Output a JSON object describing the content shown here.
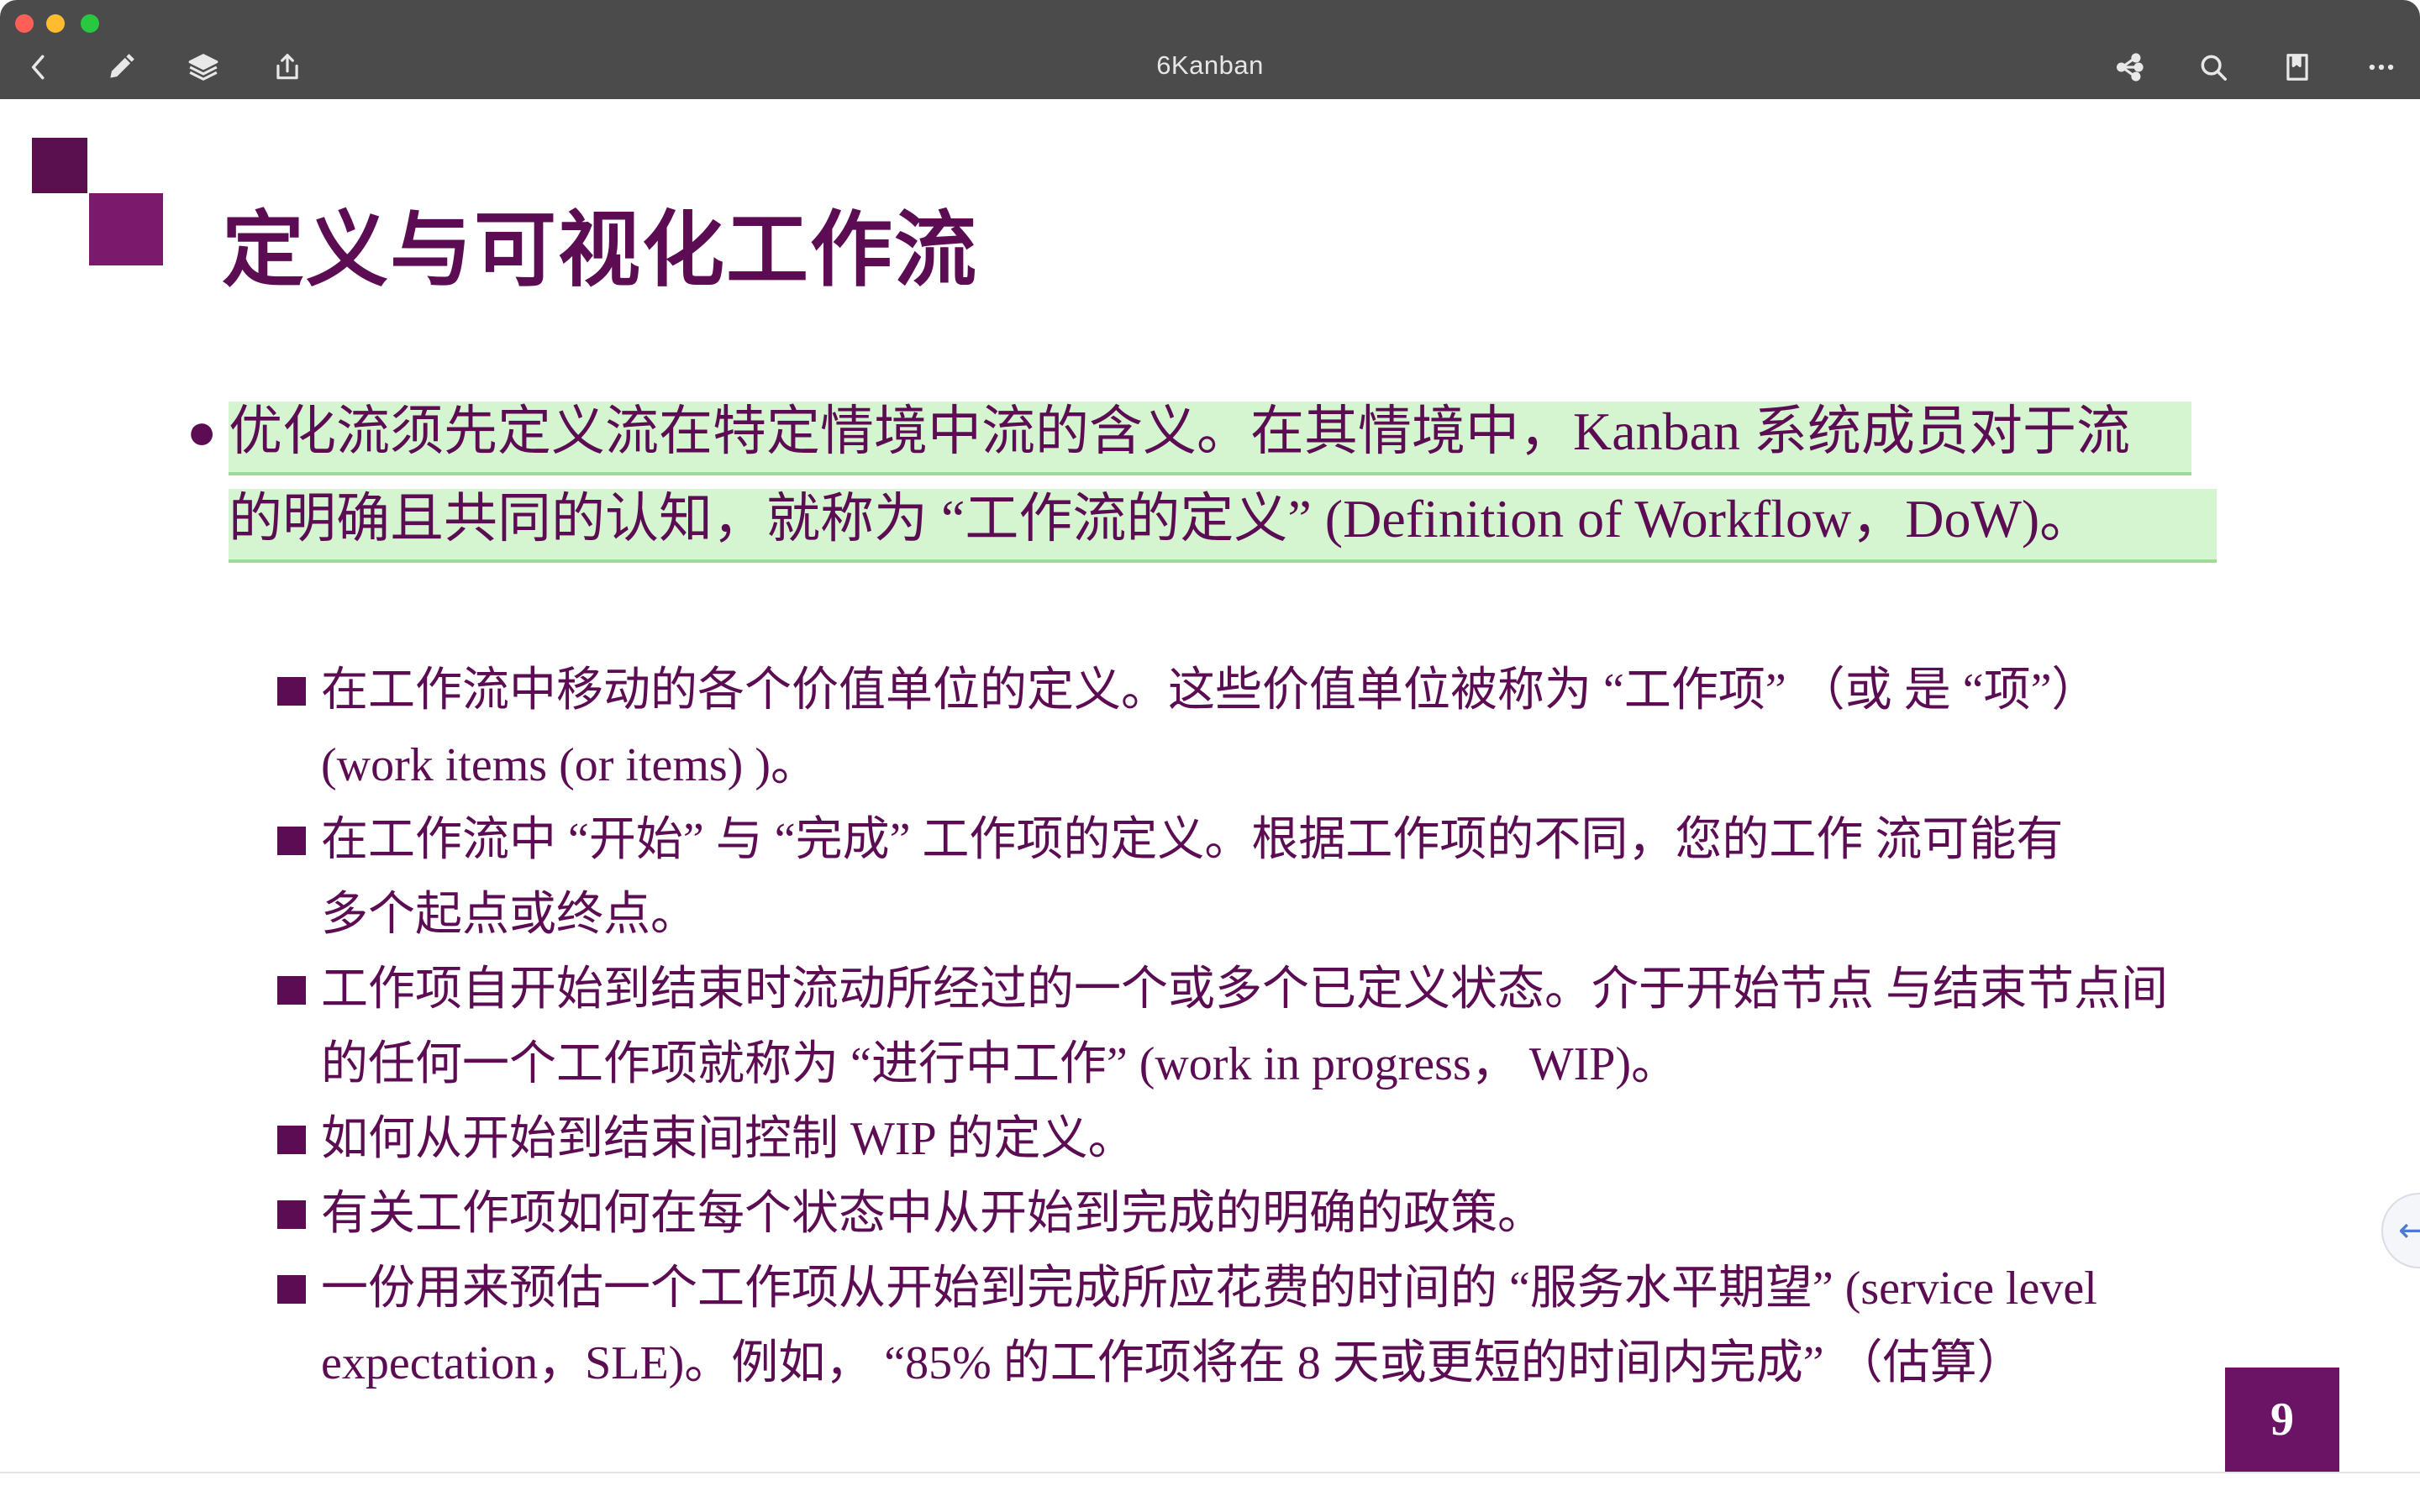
{
  "window": {
    "title": "6Kanban"
  },
  "toolbar": {
    "left_icons": [
      "back-icon",
      "pencil-icon",
      "layers-icon",
      "share-icon"
    ],
    "right_icons": [
      "mindmap-icon",
      "search-icon",
      "bookmark-icon",
      "more-icon"
    ]
  },
  "slide": {
    "title": "定义与可视化工作流",
    "main_bullet_symbol": "●",
    "main_bullet": {
      "line1": "优化流须先定义流在特定情境中流的含义。在其情境中，Kanban 系统成员对于流",
      "line2": "的明确且共同的认知，就称为 “工作流的定义” (Definition of Workflow，DoW)。"
    },
    "sub_bullets": [
      {
        "line1": "在工作流中移动的各个价值单位的定义。这些价值单位被称为 “工作项” （或 是 “项”）",
        "line2": "(work items (or items) )。"
      },
      {
        "line1": "在工作流中 “开始” 与 “完成” 工作项的定义。根据工作项的不同，您的工作 流可能有",
        "line2": "多个起点或终点。"
      },
      {
        "line1": "工作项自开始到结束时流动所经过的一个或多个已定义状态。介于开始节点 与结束节点间",
        "line2": "的任何一个工作项就称为 “进行中工作” (work in progress， WIP)。"
      },
      {
        "line1": "如何从开始到结束间控制 WIP 的定义。"
      },
      {
        "line1": "有关工作项如何在每个状态中从开始到完成的明确的政策。"
      },
      {
        "line1": "一份用来预估一个工作项从开始到完成所应花费的时间的 “服务水平期望” (service level",
        "line2": "expectation，SLE)。例如， “85% 的工作项将在 8 天或更短的时间内完成” （估算）"
      }
    ],
    "page_number": "9"
  },
  "colors": {
    "title_text": "#5c0c52",
    "highlight": "#d4f5d0",
    "titlebar": "#4b4b4b",
    "page_box": "#6b1364"
  }
}
